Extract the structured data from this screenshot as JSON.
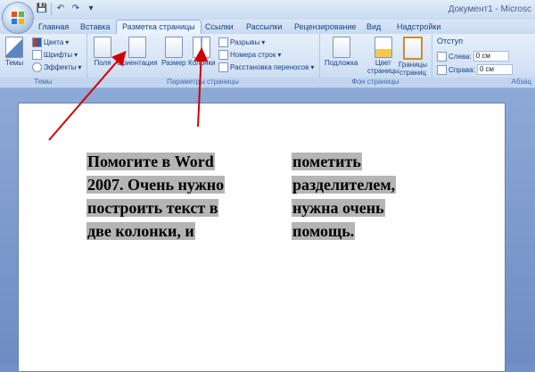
{
  "window": {
    "title": "Документ1 - Microsс"
  },
  "quick_access": [
    "save-icon",
    "undo-icon",
    "redo-icon",
    "customize-icon"
  ],
  "tabs": [
    {
      "label": "Главная"
    },
    {
      "label": "Вставка"
    },
    {
      "label": "Разметка страницы",
      "active": true
    },
    {
      "label": "Ссылки"
    },
    {
      "label": "Рассылки"
    },
    {
      "label": "Рецензирование"
    },
    {
      "label": "Вид"
    },
    {
      "label": "Надстройки"
    }
  ],
  "ribbon": {
    "themes": {
      "label": "Темы",
      "button": "Темы",
      "colors": "Цвета",
      "fonts": "Шрифты",
      "effects": "Эффекты"
    },
    "page_setup": {
      "label": "Параметры страницы",
      "fields": "Поля",
      "orientation": "Ориентация",
      "size": "Размер",
      "columns": "Колонки",
      "breaks": "Разрывы",
      "line_numbers": "Номера строк",
      "hyphenation": "Расстановка переносов"
    },
    "page_background": {
      "label": "Фон страницы",
      "watermark": "Подложка",
      "page_color_1": "Цвет",
      "page_color_2": "страницы",
      "page_borders_1": "Границы",
      "page_borders_2": "страниц"
    },
    "paragraph": {
      "label": "Абзац",
      "indent": "Отступ",
      "left_label": "Слева:",
      "left_value": "0 см",
      "right_label": "Справа:",
      "right_value": "0 см"
    }
  },
  "document": {
    "col1": [
      "Помогите в Word",
      "2007. Очень нужно",
      "построить текст в",
      "две колонки, и"
    ],
    "col2": [
      "пометить",
      "разделителем,",
      "нужна очень",
      "помощь."
    ]
  },
  "colors": {
    "arrow": "#d00000",
    "selection": "#b5b5b5"
  }
}
